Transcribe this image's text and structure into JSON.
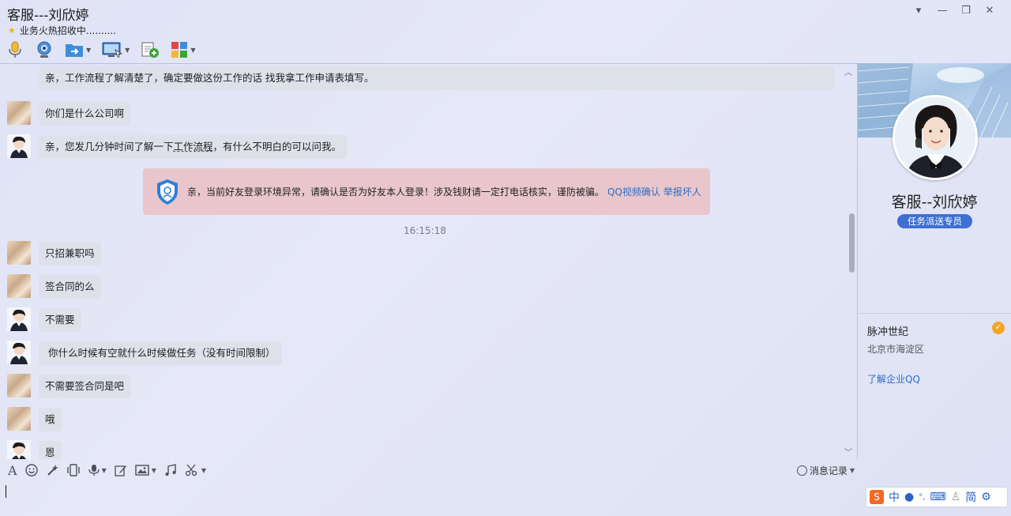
{
  "window": {
    "title": "客服---刘欣婷",
    "subtitle": "业务火热招收中..........",
    "controls": [
      "▾",
      "—",
      "❐",
      "✕"
    ]
  },
  "toolbar": {
    "items": [
      "microphone-icon",
      "video-icon",
      "file-transfer-icon",
      "screen-share-icon",
      "add-contact-icon",
      "apps-icon"
    ]
  },
  "messages": {
    "m0": "亲，工作流程了解清楚了，确定要做这份工作的话 找我拿工作申请表填写。",
    "m1": "你们是什么公司啊",
    "m2a": "亲，您发几分钟时间了解一下",
    "m2u": "工作流程",
    "m2b": "，有什么不明白的可以问我。",
    "m3": "只招兼职吗",
    "m4": "签合同的么",
    "m5": "不需要",
    "m6": "你什么时候有空就什么时候做任务（没有时间限制）",
    "m7": "不需要签合同是吧",
    "m8": "哦",
    "m9": "恩"
  },
  "warning": {
    "text": "亲，当前好友登录环境异常，请确认是否为好友本人登录！涉及钱财请一定打电话核实，谨防被骗。",
    "link1": "QQ视频确认",
    "link2": "举报坏人"
  },
  "timestamp": "16:15:18",
  "input_toolbar": {
    "history_label": "消息记录"
  },
  "profile": {
    "name": "客服--刘欣婷",
    "tag": "任务派送专员",
    "company": "脉冲世纪",
    "location": "北京市海淀区",
    "learn_more": "了解企业QQ"
  },
  "ime": {
    "mode": "中",
    "simplified": "简"
  },
  "colors": {
    "accent": "#3f6fd3",
    "link": "#2d6cc6",
    "warning_bg": "#e8c6cc",
    "bubble_bg": "#dfe1ea"
  }
}
